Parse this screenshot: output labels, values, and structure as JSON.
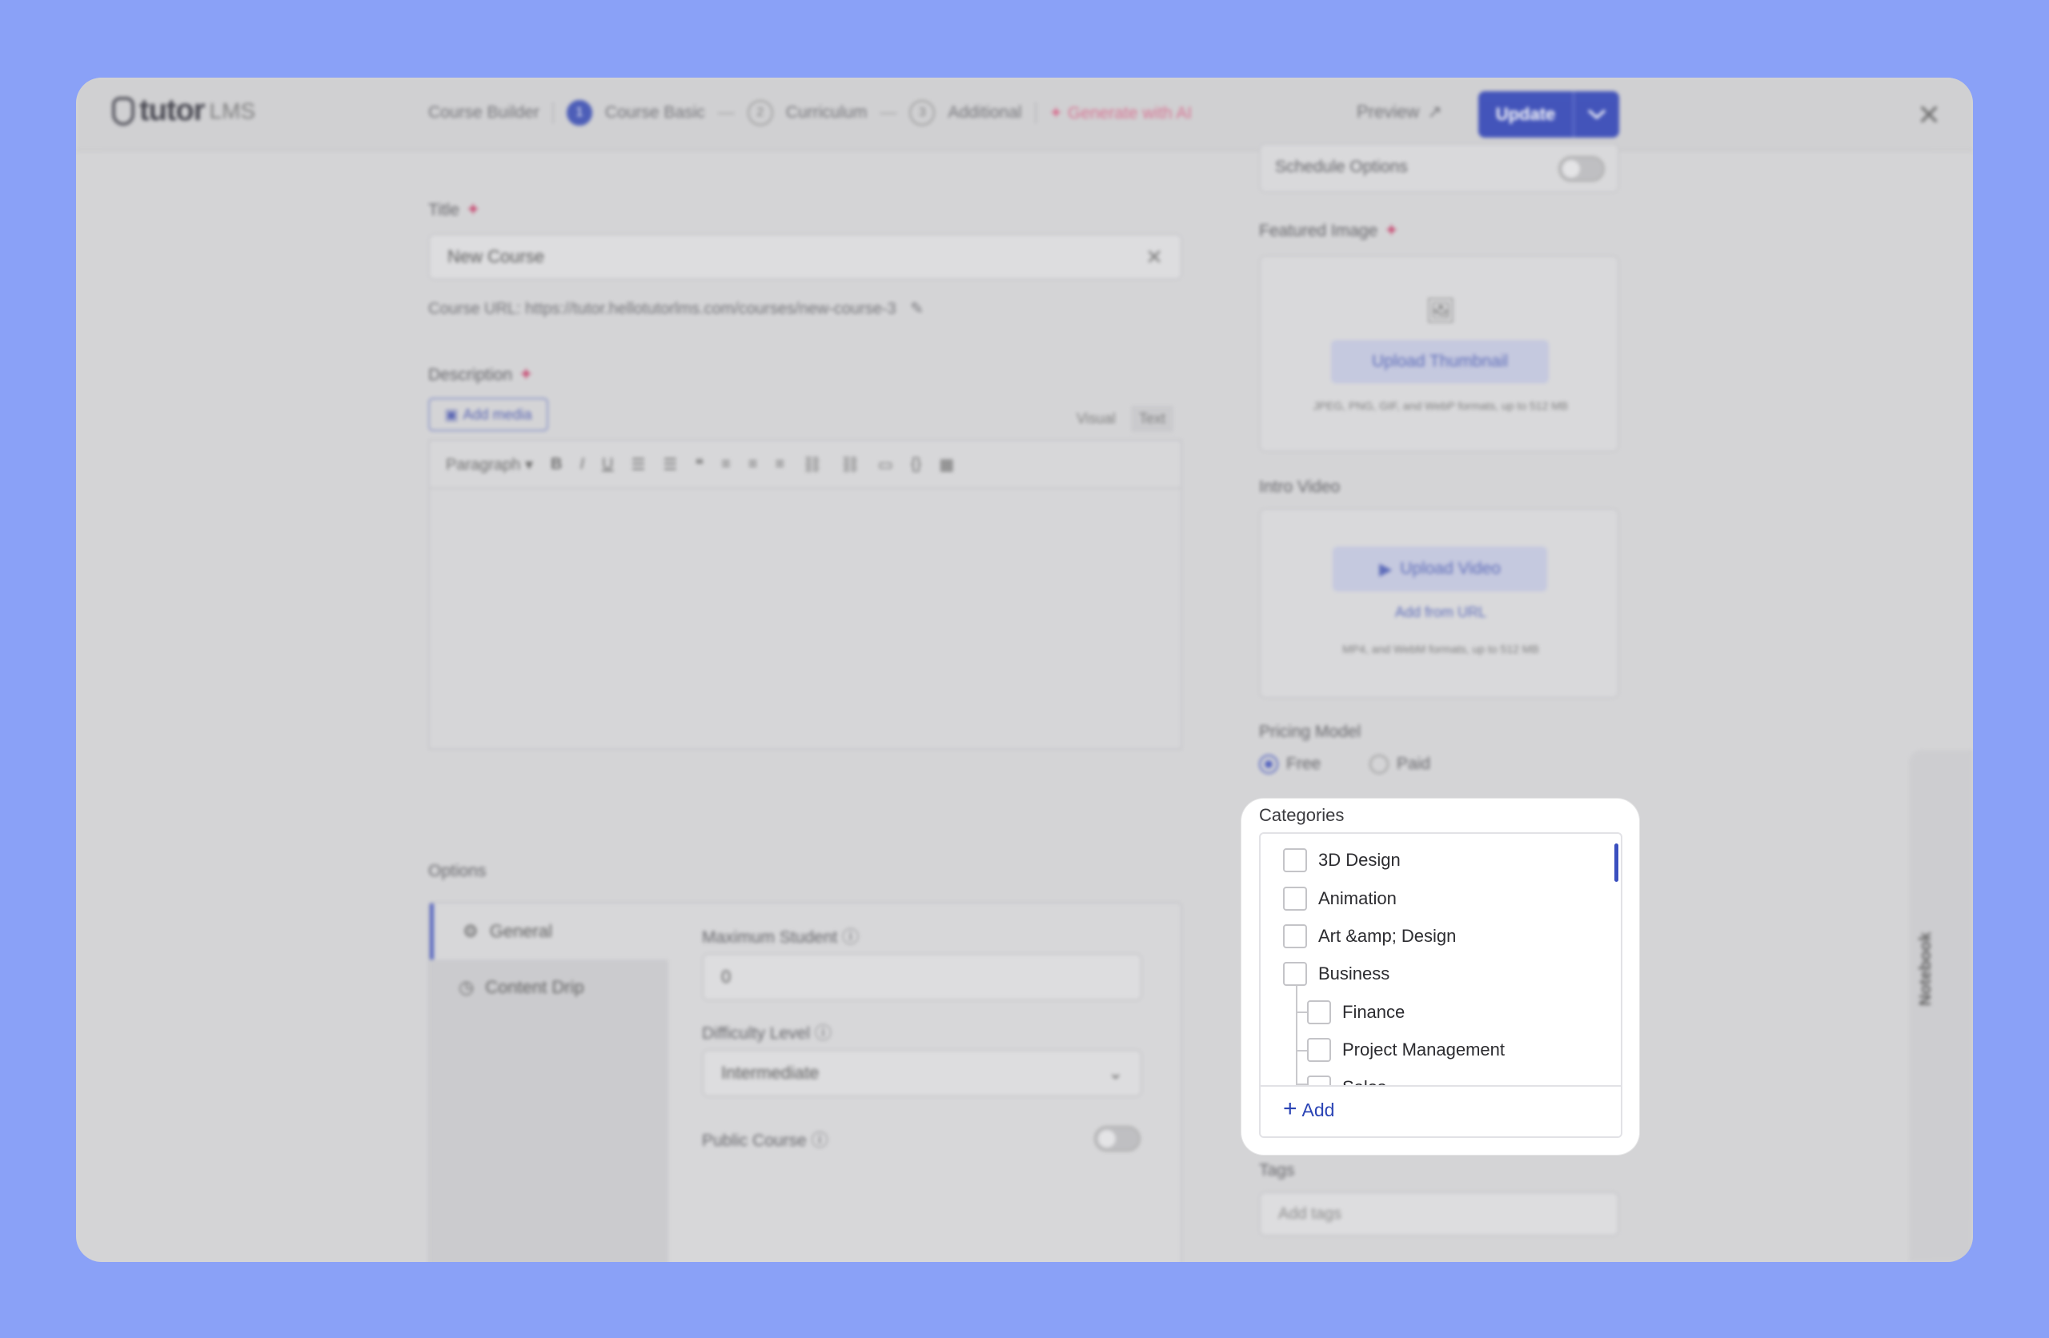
{
  "header": {
    "logo_text": "tutor",
    "logo_sub": "LMS",
    "breadcrumb_title": "Course Builder",
    "steps": [
      {
        "num": "1",
        "label": "Course Basic"
      },
      {
        "num": "2",
        "label": "Curriculum"
      },
      {
        "num": "3",
        "label": "Additional"
      }
    ],
    "ai_link": "Generate with AI",
    "preview": "Preview",
    "update": "Update"
  },
  "basics": {
    "title_label": "Title",
    "title_value": "New Course",
    "course_url": "Course URL: https://tutor.hellotutorlms.com/courses/new-course-3",
    "description_label": "Description",
    "add_media": "Add media",
    "tab_visual": "Visual",
    "tab_text": "Text",
    "format_select": "Paragraph"
  },
  "options": {
    "heading": "Options",
    "tabs": [
      "General",
      "Content Drip"
    ],
    "max_student_label": "Maximum Student",
    "max_student_value": "0",
    "difficulty_label": "Difficulty Level",
    "difficulty_value": "Intermediate",
    "public_course_label": "Public Course"
  },
  "sidebar": {
    "schedule_label": "Schedule Options",
    "featured_label": "Featured Image",
    "upload_thumbnail": "Upload Thumbnail",
    "thumbnail_note": "JPEG, PNG, GIF, and WebP formats, up to 512 MB",
    "intro_video_label": "Intro Video",
    "upload_video": "Upload Video",
    "add_from_url": "Add from URL",
    "video_note": "MP4, and WebM formats, up to 512 MB",
    "pricing_label": "Pricing Model",
    "pricing_free": "Free",
    "pricing_paid": "Paid",
    "tags_label": "Tags",
    "tags_placeholder": "Add tags",
    "notebook": "Notebook"
  },
  "categories": {
    "title": "Categories",
    "items": [
      {
        "label": "3D Design"
      },
      {
        "label": "Animation"
      },
      {
        "label": "Art &amp; Design"
      },
      {
        "label": "Business"
      },
      {
        "label": "Finance"
      },
      {
        "label": "Project Management"
      },
      {
        "label": "Sales"
      }
    ],
    "add_label": "Add"
  },
  "colors": {
    "background": "#8aa1f7",
    "accent": "#3447b8",
    "ai_pink": "#d86a8c"
  }
}
